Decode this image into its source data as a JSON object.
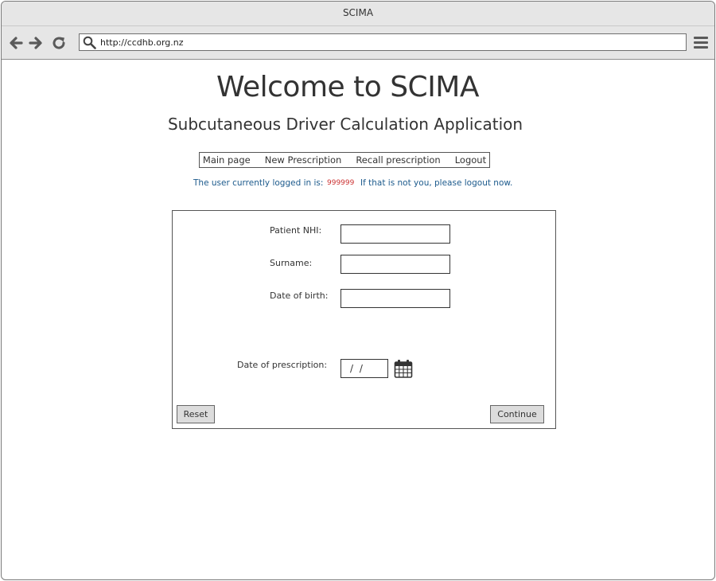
{
  "window": {
    "title": "SCIMA"
  },
  "browser": {
    "url": "http://ccdhb.org.nz",
    "icons": {
      "back": "arrow-left-icon",
      "forward": "arrow-right-icon",
      "reload": "reload-icon",
      "search": "search-icon",
      "menu": "hamburger-menu-icon"
    }
  },
  "header": {
    "title": "Welcome to SCIMA",
    "subtitle": "Subcutaneous Driver Calculation Application"
  },
  "nav": {
    "items": [
      {
        "label": "Main page"
      },
      {
        "label": "New Prescription"
      },
      {
        "label": "Recall prescription"
      },
      {
        "label": "Logout"
      }
    ]
  },
  "session": {
    "prefix": "The user currently logged in is:",
    "user_id": "999999",
    "suffix": "If that is not you, please logout now."
  },
  "form": {
    "nhi_label": "Patient NHI:",
    "nhi_value": "",
    "surname_label": "Surname:",
    "surname_value": "",
    "dob_label": "Date of birth:",
    "dob_value": "",
    "prescription_date_label": "Date of prescription:",
    "prescription_date_value": " / /",
    "calendar_icon": "calendar-icon",
    "reset_label": "Reset",
    "continue_label": "Continue"
  },
  "colors": {
    "info_text": "#1c5a8c",
    "user_id": "#cc3333",
    "chrome": "#e6e6e6"
  }
}
